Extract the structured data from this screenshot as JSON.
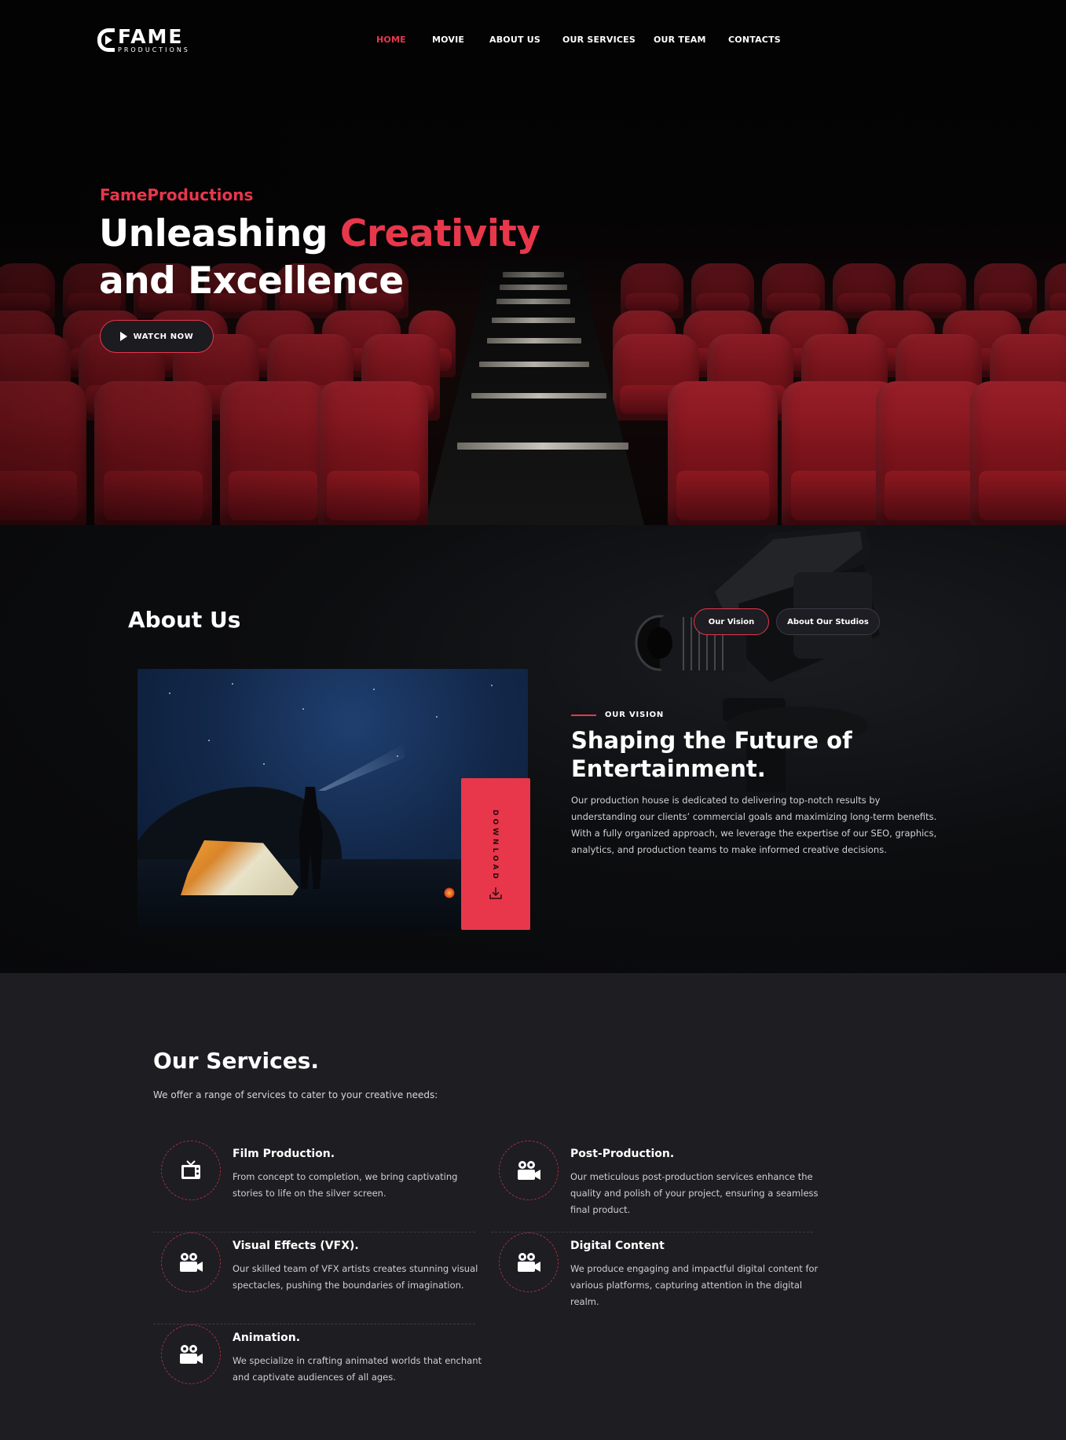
{
  "brand": {
    "name": "FAME",
    "sub": "PRODUCTIONS"
  },
  "nav": {
    "items": [
      {
        "label": "HOME",
        "active": true
      },
      {
        "label": "MOVIE",
        "active": false
      },
      {
        "label": "ABOUT US",
        "active": false
      },
      {
        "label": "OUR SERVICES",
        "active": false
      },
      {
        "label": "OUR TEAM",
        "active": false
      },
      {
        "label": "CONTACTS",
        "active": false
      }
    ]
  },
  "hero": {
    "eyebrow": "FameProductions",
    "title_part1": "Unleashing ",
    "title_accent": "Creativity",
    "title_part2": "and Excellence",
    "watch_label": "WATCH NOW"
  },
  "about": {
    "title": "About Us",
    "tabs": [
      "Our Vision",
      "About Our Studios"
    ],
    "download_label": "DOWNLOAD",
    "vision_label": "OUR VISION",
    "vision_title": "Shaping the Future of Entertainment.",
    "vision_body": "Our production house is dedicated to delivering top-notch results by understanding our clients’ commercial goals and maximizing long-term benefits. With a fully organized approach, we leverage the expertise of our SEO, graphics, analytics, and production teams to make informed creative decisions."
  },
  "services": {
    "title": "Our Services.",
    "subtitle": "We offer a range of services to cater to your creative needs:",
    "items": [
      {
        "title": "Film Production.",
        "desc": "From concept to completion, we bring captivating stories to life on the silver screen.",
        "icon": "tv-icon"
      },
      {
        "title": "Post-Production.",
        "desc": "Our meticulous post-production services enhance the quality and polish of your project, ensuring a seamless final product.",
        "icon": "video-camera-icon"
      },
      {
        "title": "Visual Effects (VFX).",
        "desc": "Our skilled team of VFX artists creates stunning visual spectacles, pushing the boundaries of imagination.",
        "icon": "video-camera-icon"
      },
      {
        "title": "Digital Content",
        "desc": "We produce engaging and impactful digital content for various platforms, capturing attention in the digital realm.",
        "icon": "video-camera-icon"
      },
      {
        "title": "Animation.",
        "desc": "We specialize in crafting animated worlds that enchant and captivate audiences of all ages.",
        "icon": "video-camera-icon"
      }
    ]
  },
  "colors": {
    "accent": "#e8374b",
    "hero_bg": "#040405",
    "services_bg": "#1d1d22"
  }
}
